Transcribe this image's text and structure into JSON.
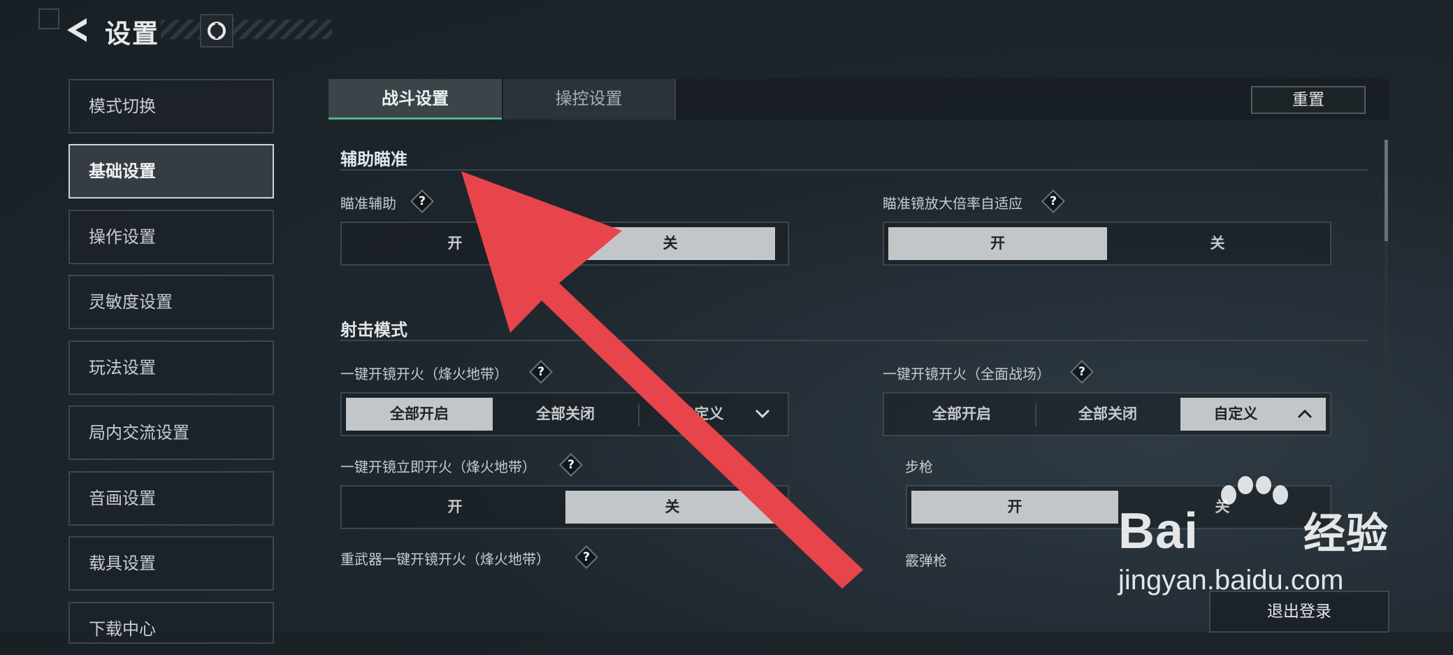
{
  "header": {
    "title": "设置"
  },
  "sidebar": {
    "items": [
      {
        "label": "模式切换"
      },
      {
        "label": "基础设置"
      },
      {
        "label": "操作设置"
      },
      {
        "label": "灵敏度设置"
      },
      {
        "label": "玩法设置"
      },
      {
        "label": "局内交流设置"
      },
      {
        "label": "音画设置"
      },
      {
        "label": "载具设置"
      },
      {
        "label": "下载中心"
      }
    ],
    "active_index": 1
  },
  "tabs": [
    {
      "label": "战斗设置",
      "active": true
    },
    {
      "label": "操控设置",
      "active": false
    }
  ],
  "reset_label": "重置",
  "aim": {
    "section_title": "辅助瞄准",
    "aim_assist": {
      "label": "瞄准辅助",
      "on": "开",
      "off": "关",
      "selected": "关"
    },
    "scope_adapt": {
      "label": "瞄准镜放大倍率自适应",
      "on": "开",
      "off": "关",
      "selected": "开"
    }
  },
  "fire": {
    "section_title": "射击模式",
    "scope_fire_warzone": {
      "label": "一键开镜开火（烽火地带）",
      "options": [
        "全部开启",
        "全部关闭",
        "自定义"
      ],
      "selected": "全部开启",
      "expand": "collapsed"
    },
    "scope_fire_fullscale": {
      "label": "一键开镜开火（全面战场）",
      "options": [
        "全部开启",
        "全部关闭",
        "自定义"
      ],
      "selected": "自定义",
      "expand": "expanded"
    },
    "instant_fire_warzone": {
      "label": "一键开镜立即开火（烽火地带）",
      "on": "开",
      "off": "关",
      "selected": "关"
    },
    "rifle": {
      "label": "步枪",
      "on": "开",
      "off": "关",
      "selected": "开"
    },
    "heavy_weapon": {
      "label": "重武器一键开镜开火（烽火地带）"
    },
    "shotgun": {
      "label": "霰弹枪"
    }
  },
  "help_glyph": "?",
  "logout_label": "退出登录",
  "watermark": {
    "brand": "Bai",
    "brand2": "经验",
    "url": "jingyan.baidu.com"
  },
  "colors": {
    "accent": "#4fb58a",
    "selected_option": "#c3c6c8",
    "arrow": "#e8444b"
  }
}
